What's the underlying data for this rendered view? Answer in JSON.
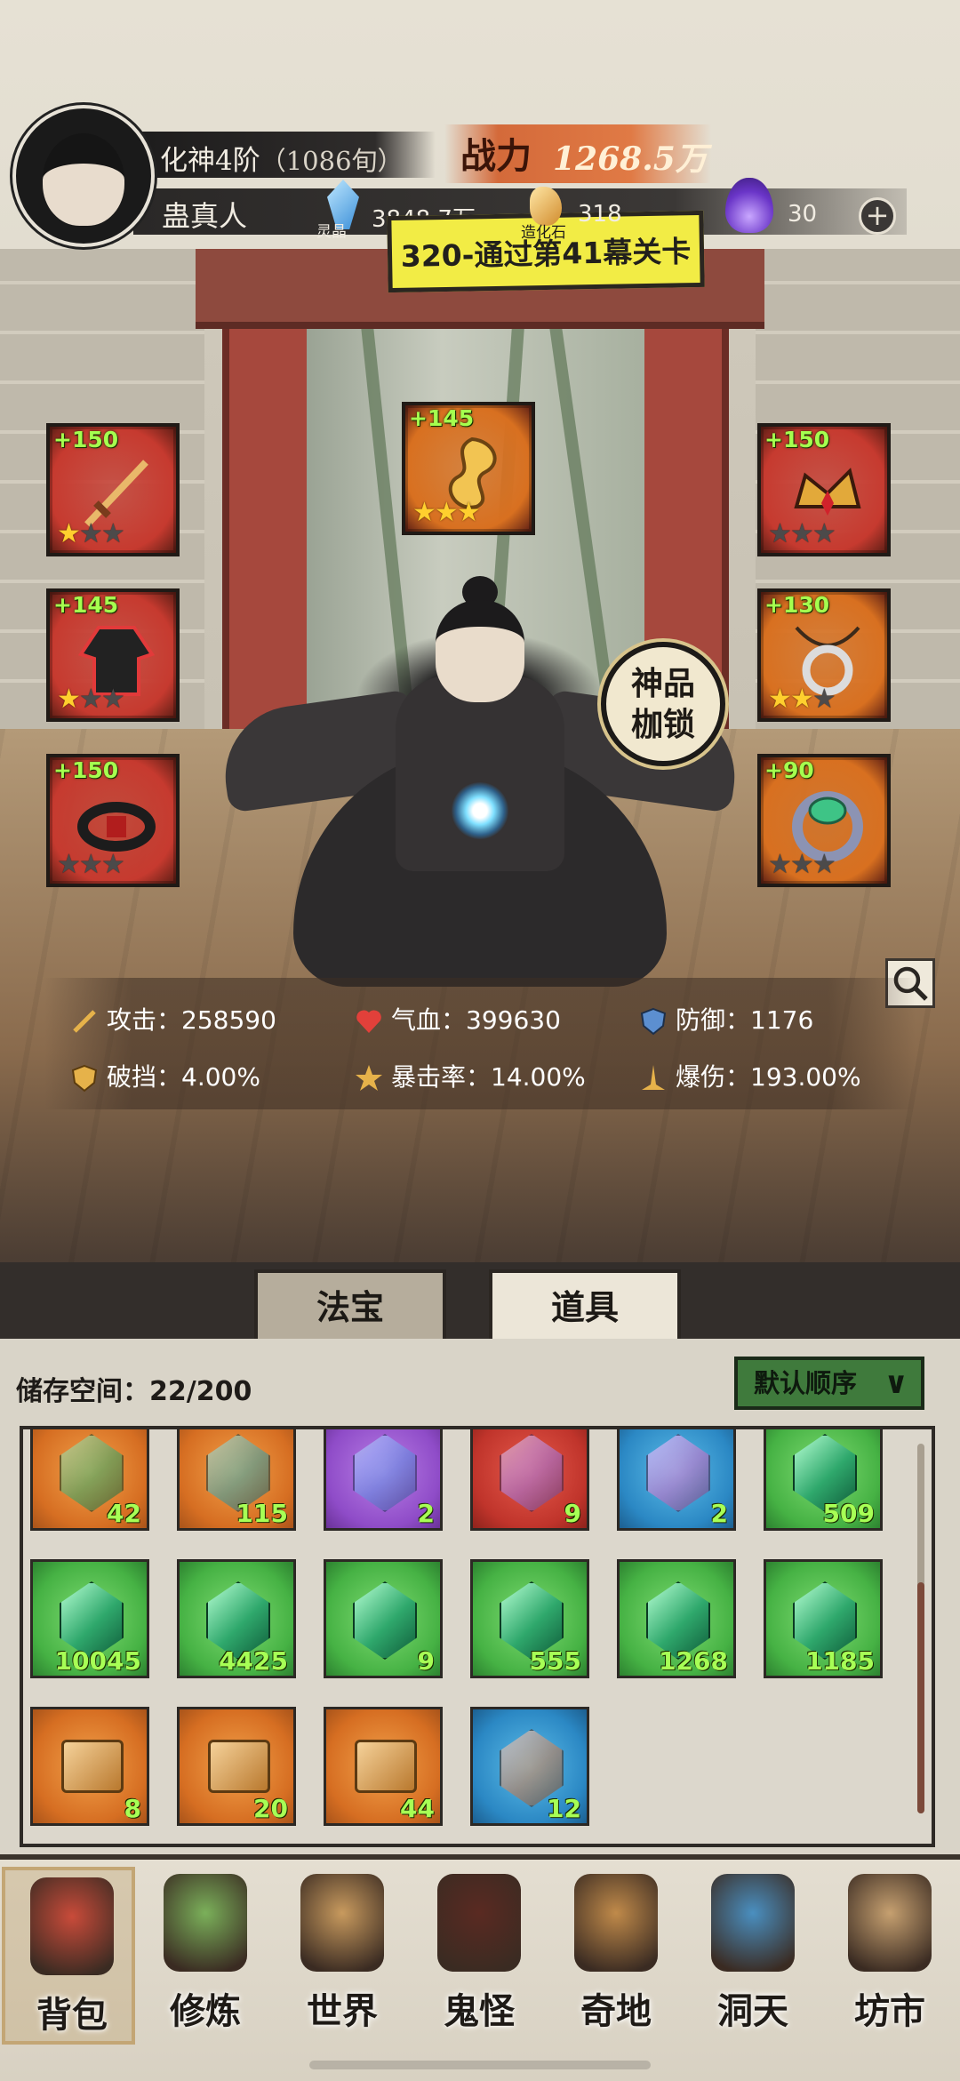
{
  "header": {
    "realm": "化神4阶",
    "age": "（1086旬）",
    "player_name": "蛊真人",
    "power_label": "战力",
    "power_value": "1268.5万",
    "crystal_label": "灵晶",
    "crystal_value": "3848.7万",
    "stone_label": "造化石",
    "stone_value": "318",
    "flame_value": "30",
    "plus_glyph": "+"
  },
  "quest": {
    "text": "320-通过第41幕关卡"
  },
  "equipment": {
    "slots": [
      {
        "level": "+150",
        "stars": 1,
        "color": "#c63a2f",
        "icon": "sword-icon"
      },
      {
        "level": "+145",
        "stars": 3,
        "color": "#d87020",
        "icon": "golden-dragon-icon"
      },
      {
        "level": "+150",
        "stars": 0,
        "color": "#c63a2f",
        "icon": "crown-icon"
      },
      {
        "level": "+145",
        "stars": 1,
        "color": "#c63a2f",
        "icon": "robe-icon"
      },
      {
        "level": "+130",
        "stars": 2,
        "color": "#d87020",
        "icon": "pendant-icon"
      },
      {
        "level": "+150",
        "stars": 0,
        "color": "#c63a2f",
        "icon": "belt-icon"
      },
      {
        "level": "+90",
        "stars": 0,
        "color": "#d87020",
        "icon": "ring-icon"
      }
    ],
    "badge_line1": "神品",
    "badge_line2": "枷锁"
  },
  "stats": {
    "attack": "攻击：258590",
    "hp": "气血：399630",
    "defense": "防御：1176",
    "block_break": "破挡：4.00%",
    "crit_rate": "暴击率：14.00%",
    "crit_damage": "爆伤：193.00%"
  },
  "tabs": [
    {
      "label": "法宝"
    },
    {
      "label": "道具"
    }
  ],
  "inventory": {
    "storage_label": "储存空间：22/200",
    "sort_label": "默认顺序",
    "items": [
      {
        "count": "42",
        "rarity": "orange",
        "icon": "swirl-icon"
      },
      {
        "count": "115",
        "rarity": "orange",
        "icon": "crystal-shard-icon"
      },
      {
        "count": "2",
        "rarity": "purple",
        "icon": "cloth-icon"
      },
      {
        "count": "9",
        "rarity": "red",
        "icon": "token-icon"
      },
      {
        "count": "2",
        "rarity": "blue",
        "icon": "boot-icon"
      },
      {
        "count": "509",
        "rarity": "green",
        "icon": "jade-gem-icon"
      },
      {
        "count": "10045",
        "rarity": "green",
        "icon": "jade-gem-icon"
      },
      {
        "count": "4425",
        "rarity": "green",
        "icon": "jade-gem-icon"
      },
      {
        "count": "9",
        "rarity": "green",
        "icon": "jade-gem-icon"
      },
      {
        "count": "555",
        "rarity": "green",
        "icon": "jade-gem-icon"
      },
      {
        "count": "1268",
        "rarity": "green",
        "icon": "jade-gem-icon"
      },
      {
        "count": "1185",
        "rarity": "green",
        "icon": "jade-gem-icon"
      },
      {
        "count": "8",
        "rarity": "orange",
        "icon": "puzzle-piece-icon"
      },
      {
        "count": "20",
        "rarity": "orange",
        "icon": "puzzle-piece-icon"
      },
      {
        "count": "44",
        "rarity": "orange",
        "icon": "puzzle-piece-icon"
      },
      {
        "count": "12",
        "rarity": "blue",
        "icon": "lotus-icon"
      }
    ]
  },
  "nav": [
    {
      "label": "背包",
      "icon": "bag-icon",
      "active": true
    },
    {
      "label": "修炼",
      "icon": "herb-icon"
    },
    {
      "label": "世界",
      "icon": "scroll-icon"
    },
    {
      "label": "鬼怪",
      "icon": "demon-egg-icon"
    },
    {
      "label": "奇地",
      "icon": "pagoda-icon"
    },
    {
      "label": "洞天",
      "icon": "portal-icon"
    },
    {
      "label": "坊市",
      "icon": "market-icon"
    }
  ]
}
